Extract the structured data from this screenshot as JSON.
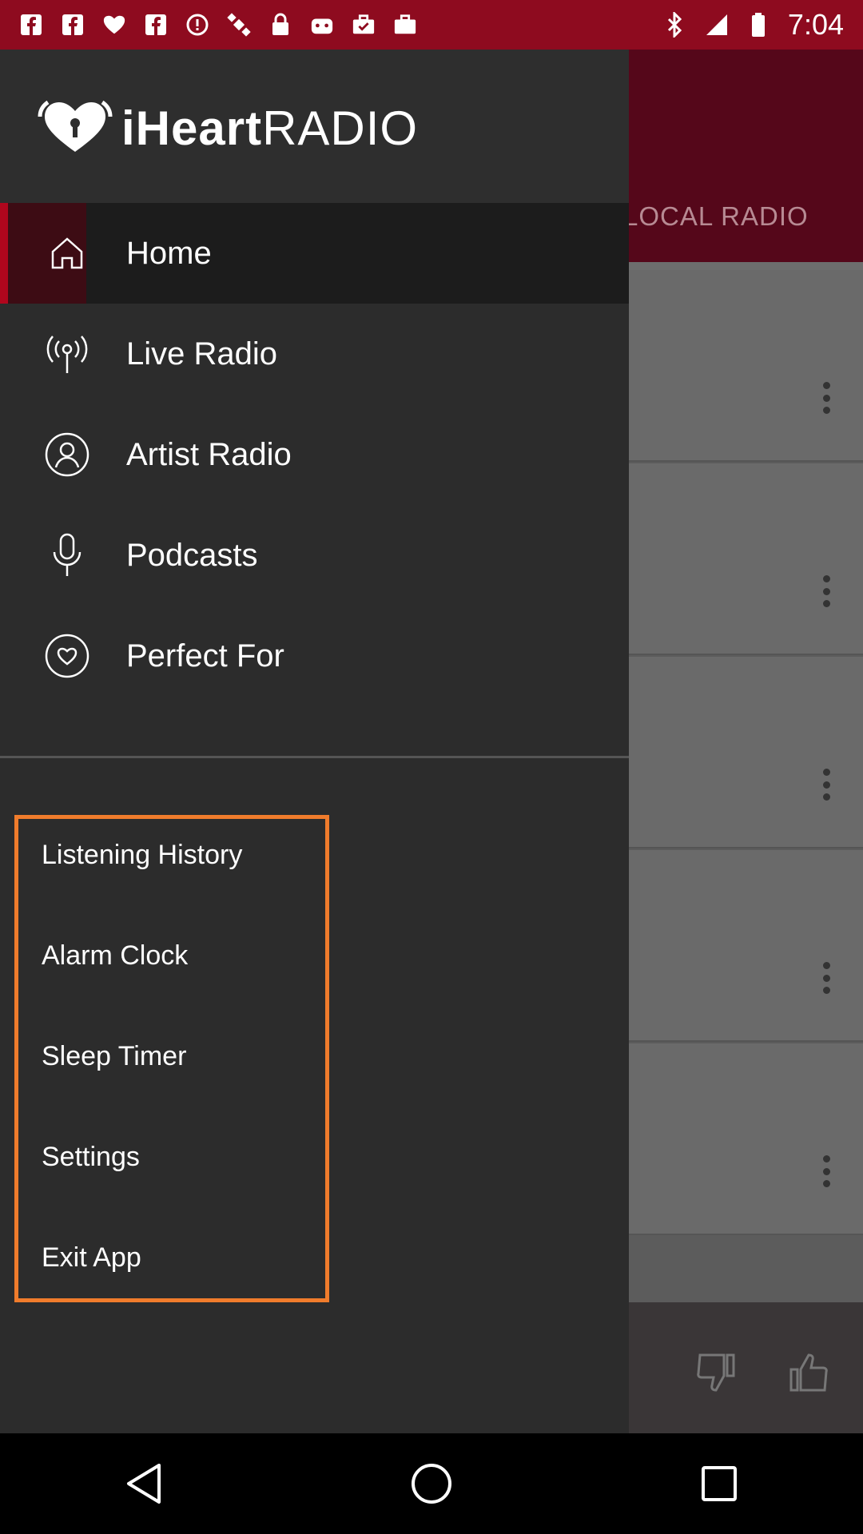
{
  "app": {
    "name": "iHeartRADIO",
    "logo_bold": "iHeart",
    "logo_light": "RADIO",
    "brand_color": "#b0061d"
  },
  "status_bar": {
    "time": "7:04",
    "icons": [
      "facebook-icon",
      "facebook-icon",
      "iheart-icon",
      "facebook-icon",
      "alert-icon",
      "satellite-icon",
      "lock-icon",
      "android-icon",
      "briefcase-check-icon",
      "briefcase-icon",
      "bluetooth-icon",
      "signal-icon",
      "battery-icon"
    ],
    "color": "#8e0b1f"
  },
  "background": {
    "tab_label": "LOCAL RADIO",
    "rows": 5
  },
  "drawer": {
    "nav_items": [
      {
        "label": "Home",
        "icon": "home-icon",
        "active": true
      },
      {
        "label": "Live Radio",
        "icon": "broadcast-icon",
        "active": false
      },
      {
        "label": "Artist Radio",
        "icon": "artist-icon",
        "active": false
      },
      {
        "label": "Podcasts",
        "icon": "microphone-icon",
        "active": false
      },
      {
        "label": "Perfect For",
        "icon": "heart-circle-icon",
        "active": false
      }
    ],
    "secondary_items": [
      {
        "label": "Listening History"
      },
      {
        "label": "Alarm Clock"
      },
      {
        "label": "Sleep Timer"
      },
      {
        "label": "Settings"
      },
      {
        "label": "Exit App"
      }
    ],
    "highlight_color": "#f07c2c"
  },
  "player": {
    "thumbs_down_icon": "thumbs-down-icon",
    "thumbs_up_icon": "thumbs-up-icon"
  },
  "navbar": {
    "back": "back-icon",
    "home": "home-circle-icon",
    "recents": "recents-icon"
  }
}
